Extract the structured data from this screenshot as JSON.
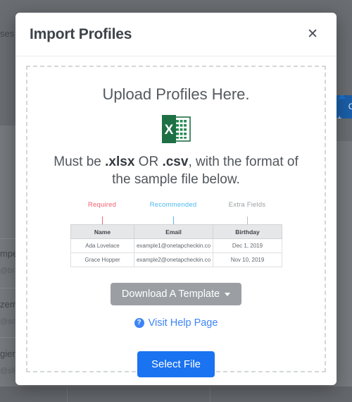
{
  "background": {
    "list_items": [
      {
        "name": "ses",
        "handle": ""
      },
      {
        "name": "mpe",
        "handle": "@brav"
      },
      {
        "name": "zem",
        "handle": "@sci"
      },
      {
        "name": "gier",
        "handle": "@slid"
      }
    ],
    "action_button": {
      "icon": "person-add-icon",
      "label": "C"
    }
  },
  "modal": {
    "title": "Import Profiles",
    "close_label": "✕",
    "dropzone": {
      "heading": "Upload Profiles Here.",
      "file_icon": "excel-file-icon",
      "description_prefix": "Must be ",
      "format_1": ".xlsx",
      "description_middle": " OR ",
      "format_2": ".csv",
      "description_suffix": ", with the format of the sample file below."
    },
    "annotations": [
      {
        "label": "Required",
        "color": "#f4606e"
      },
      {
        "label": "Recommended",
        "color": "#4fb9ee"
      },
      {
        "label": "Extra Fields",
        "color": "#9a9ea2"
      }
    ],
    "sample_table": {
      "columns": [
        "Name",
        "Email",
        "Birthday"
      ],
      "rows": [
        [
          "Ada Lovelace",
          "example1@onetapcheckin.co",
          "Dec 1, 2019"
        ],
        [
          "Grace Hopper",
          "example2@onetapcheckin.co",
          "Nov 10, 2019"
        ]
      ]
    },
    "template_button": {
      "label": "Download A Template",
      "caret": "caret-down-icon"
    },
    "help_link": {
      "icon": "question-circle-icon",
      "label": "Visit Help Page",
      "glyph": "?"
    },
    "select_button": {
      "label": "Select File",
      "color": "#1a73f0"
    }
  }
}
